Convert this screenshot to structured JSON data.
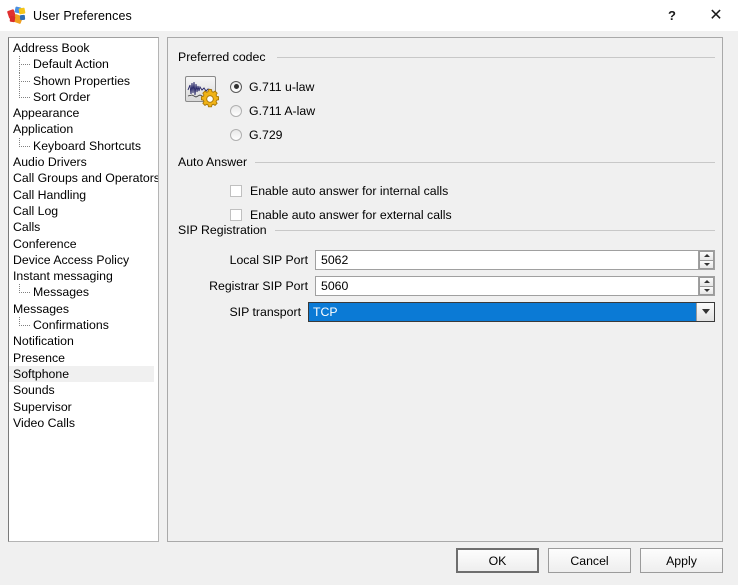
{
  "window": {
    "title": "User Preferences",
    "app_icon": "app-colorful-icon",
    "help_label": "?",
    "close_label": "✕"
  },
  "sidebar": {
    "items": [
      {
        "label": "Address Book",
        "level": 0,
        "selected": false,
        "last_child": false
      },
      {
        "label": "Default Action",
        "level": 1,
        "selected": false,
        "last_child": false
      },
      {
        "label": "Shown Properties",
        "level": 1,
        "selected": false,
        "last_child": false
      },
      {
        "label": "Sort Order",
        "level": 1,
        "selected": false,
        "last_child": true
      },
      {
        "label": "Appearance",
        "level": 0,
        "selected": false,
        "last_child": false
      },
      {
        "label": "Application",
        "level": 0,
        "selected": false,
        "last_child": false
      },
      {
        "label": "Keyboard Shortcuts",
        "level": 1,
        "selected": false,
        "last_child": true
      },
      {
        "label": "Audio Drivers",
        "level": 0,
        "selected": false,
        "last_child": false
      },
      {
        "label": "Call Groups and Operators",
        "level": 0,
        "selected": false,
        "last_child": false
      },
      {
        "label": "Call Handling",
        "level": 0,
        "selected": false,
        "last_child": false
      },
      {
        "label": "Call Log",
        "level": 0,
        "selected": false,
        "last_child": false
      },
      {
        "label": "Calls",
        "level": 0,
        "selected": false,
        "last_child": false
      },
      {
        "label": "Conference",
        "level": 0,
        "selected": false,
        "last_child": false
      },
      {
        "label": "Device Access Policy",
        "level": 0,
        "selected": false,
        "last_child": false
      },
      {
        "label": "Instant messaging",
        "level": 0,
        "selected": false,
        "last_child": false
      },
      {
        "label": "Messages",
        "level": 1,
        "selected": false,
        "last_child": true
      },
      {
        "label": "Messages",
        "level": 0,
        "selected": false,
        "last_child": false
      },
      {
        "label": "Confirmations",
        "level": 1,
        "selected": false,
        "last_child": true
      },
      {
        "label": "Notification",
        "level": 0,
        "selected": false,
        "last_child": false
      },
      {
        "label": "Presence",
        "level": 0,
        "selected": false,
        "last_child": false
      },
      {
        "label": "Softphone",
        "level": 0,
        "selected": true,
        "last_child": false
      },
      {
        "label": "Sounds",
        "level": 0,
        "selected": false,
        "last_child": false
      },
      {
        "label": "Supervisor",
        "level": 0,
        "selected": false,
        "last_child": false
      },
      {
        "label": "Video Calls",
        "level": 0,
        "selected": false,
        "last_child": false
      }
    ]
  },
  "main": {
    "codec_group": {
      "legend": "Preferred codec",
      "icon": "audio-codec-settings-icon",
      "options": [
        {
          "label": "G.711 u-law",
          "selected": true
        },
        {
          "label": "G.711 A-law",
          "selected": false
        },
        {
          "label": "G.729",
          "selected": false
        }
      ]
    },
    "auto_answer_group": {
      "legend": "Auto Answer",
      "checkboxes": [
        {
          "label": "Enable auto answer for internal calls",
          "checked": false
        },
        {
          "label": "Enable auto answer for external calls",
          "checked": false
        }
      ]
    },
    "sip_group": {
      "legend": "SIP Registration",
      "local_sip_port": {
        "label": "Local SIP Port",
        "value": "5062"
      },
      "registrar_sip_port": {
        "label": "Registrar SIP Port",
        "value": "5060"
      },
      "sip_transport": {
        "label": "SIP transport",
        "value": "TCP"
      }
    }
  },
  "footer": {
    "ok_label": "OK",
    "cancel_label": "Cancel",
    "apply_label": "Apply"
  },
  "colors": {
    "selection_blue": "#0b7ad5",
    "tree_selected_bg": "#f0f0f0",
    "dialog_bg": "#f0f0f0",
    "group_line": "#c8c8c8"
  }
}
